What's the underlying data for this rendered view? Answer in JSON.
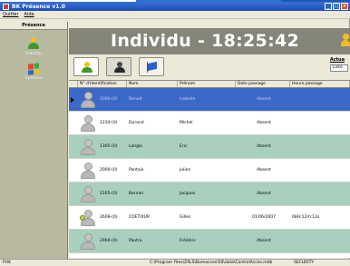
{
  "window": {
    "title": "BK Présence v1.0"
  },
  "menu": {
    "items": [
      "Quitter",
      "Aide"
    ]
  },
  "sidebar": {
    "header": "Présence",
    "items": [
      {
        "label": "Individu",
        "icon": "person-icon"
      },
      {
        "label": "Système",
        "icon": "windows-icon"
      }
    ]
  },
  "header": {
    "title": "Individu - 18:25:42"
  },
  "toolbar": {
    "tabs": [
      {
        "name": "individual",
        "icon": "person-icon"
      },
      {
        "name": "group",
        "icon": "person-dark-icon"
      },
      {
        "name": "flag",
        "icon": "flag-icon"
      }
    ],
    "filter_label": "Actua",
    "filter_value": "Liste"
  },
  "grid": {
    "columns": [
      "N° d'identification",
      "Nom",
      "Prénom",
      "Date passage",
      "Heure passage"
    ],
    "rows": [
      {
        "id": "1000-(0)",
        "nom": "Benoit",
        "prenom": "Isabelle",
        "date": "Absent",
        "heure": "",
        "style": "selected"
      },
      {
        "id": "1234-(0)",
        "nom": "Durand",
        "prenom": "Michel",
        "date": "Absent",
        "heure": "",
        "style": "white"
      },
      {
        "id": "1305-(0)",
        "nom": "Langlo",
        "prenom": "Eric",
        "date": "Absent",
        "heure": "",
        "style": "green"
      },
      {
        "id": "2000-(0)",
        "nom": "Pantaix",
        "prenom": "Julien",
        "date": "Absent",
        "heure": "",
        "style": "white"
      },
      {
        "id": "2165-(0)",
        "nom": "Bernari",
        "prenom": "Jacques",
        "date": "Absent",
        "heure": "",
        "style": "green"
      },
      {
        "id": "2608-(0)",
        "nom": "COETIXUR",
        "prenom": "Gilles",
        "date": "01/06/2007",
        "heure": "08H:12m:12s",
        "style": "white"
      },
      {
        "id": "2904-(0)",
        "nom": "Pautra",
        "prenom": "Frédéric",
        "date": "Absent",
        "heure": "",
        "style": "green"
      }
    ]
  },
  "status": {
    "left": "Prêt",
    "path": "C:\\Program Files\\ZALS\\Bomacces\\50\\data\\ControlAcces.mdb",
    "right": "SECURITY"
  },
  "colors": {
    "header_bg": "#85857a",
    "row_green": "#a9d0bd",
    "row_selected": "#3c68c8",
    "sidebar_bg": "#b9b9a0"
  }
}
